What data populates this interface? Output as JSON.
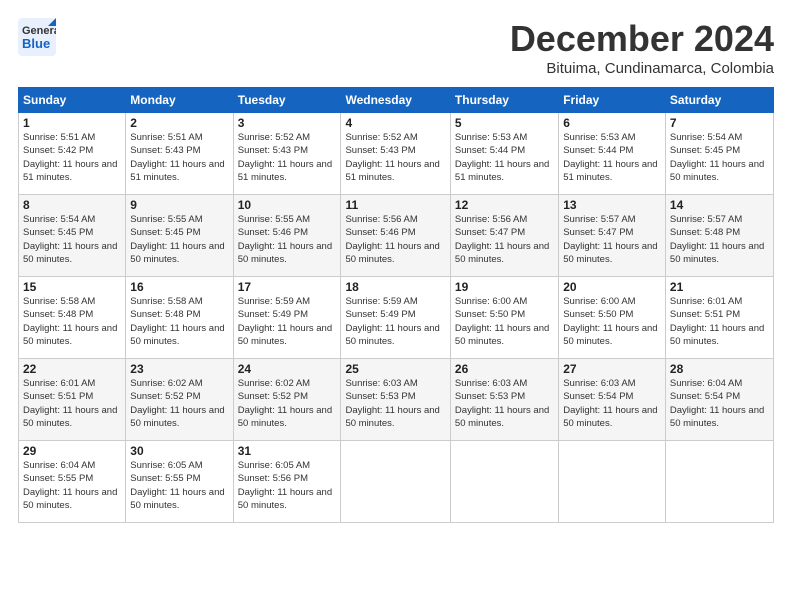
{
  "logo": {
    "line1": "General",
    "line2": "Blue"
  },
  "title": "December 2024",
  "subtitle": "Bituima, Cundinamarca, Colombia",
  "days_header": [
    "Sunday",
    "Monday",
    "Tuesday",
    "Wednesday",
    "Thursday",
    "Friday",
    "Saturday"
  ],
  "weeks": [
    [
      {
        "day": "1",
        "sunrise": "Sunrise: 5:51 AM",
        "sunset": "Sunset: 5:42 PM",
        "daylight": "Daylight: 11 hours and 51 minutes."
      },
      {
        "day": "2",
        "sunrise": "Sunrise: 5:51 AM",
        "sunset": "Sunset: 5:43 PM",
        "daylight": "Daylight: 11 hours and 51 minutes."
      },
      {
        "day": "3",
        "sunrise": "Sunrise: 5:52 AM",
        "sunset": "Sunset: 5:43 PM",
        "daylight": "Daylight: 11 hours and 51 minutes."
      },
      {
        "day": "4",
        "sunrise": "Sunrise: 5:52 AM",
        "sunset": "Sunset: 5:43 PM",
        "daylight": "Daylight: 11 hours and 51 minutes."
      },
      {
        "day": "5",
        "sunrise": "Sunrise: 5:53 AM",
        "sunset": "Sunset: 5:44 PM",
        "daylight": "Daylight: 11 hours and 51 minutes."
      },
      {
        "day": "6",
        "sunrise": "Sunrise: 5:53 AM",
        "sunset": "Sunset: 5:44 PM",
        "daylight": "Daylight: 11 hours and 51 minutes."
      },
      {
        "day": "7",
        "sunrise": "Sunrise: 5:54 AM",
        "sunset": "Sunset: 5:45 PM",
        "daylight": "Daylight: 11 hours and 50 minutes."
      }
    ],
    [
      {
        "day": "8",
        "sunrise": "Sunrise: 5:54 AM",
        "sunset": "Sunset: 5:45 PM",
        "daylight": "Daylight: 11 hours and 50 minutes."
      },
      {
        "day": "9",
        "sunrise": "Sunrise: 5:55 AM",
        "sunset": "Sunset: 5:45 PM",
        "daylight": "Daylight: 11 hours and 50 minutes."
      },
      {
        "day": "10",
        "sunrise": "Sunrise: 5:55 AM",
        "sunset": "Sunset: 5:46 PM",
        "daylight": "Daylight: 11 hours and 50 minutes."
      },
      {
        "day": "11",
        "sunrise": "Sunrise: 5:56 AM",
        "sunset": "Sunset: 5:46 PM",
        "daylight": "Daylight: 11 hours and 50 minutes."
      },
      {
        "day": "12",
        "sunrise": "Sunrise: 5:56 AM",
        "sunset": "Sunset: 5:47 PM",
        "daylight": "Daylight: 11 hours and 50 minutes."
      },
      {
        "day": "13",
        "sunrise": "Sunrise: 5:57 AM",
        "sunset": "Sunset: 5:47 PM",
        "daylight": "Daylight: 11 hours and 50 minutes."
      },
      {
        "day": "14",
        "sunrise": "Sunrise: 5:57 AM",
        "sunset": "Sunset: 5:48 PM",
        "daylight": "Daylight: 11 hours and 50 minutes."
      }
    ],
    [
      {
        "day": "15",
        "sunrise": "Sunrise: 5:58 AM",
        "sunset": "Sunset: 5:48 PM",
        "daylight": "Daylight: 11 hours and 50 minutes."
      },
      {
        "day": "16",
        "sunrise": "Sunrise: 5:58 AM",
        "sunset": "Sunset: 5:48 PM",
        "daylight": "Daylight: 11 hours and 50 minutes."
      },
      {
        "day": "17",
        "sunrise": "Sunrise: 5:59 AM",
        "sunset": "Sunset: 5:49 PM",
        "daylight": "Daylight: 11 hours and 50 minutes."
      },
      {
        "day": "18",
        "sunrise": "Sunrise: 5:59 AM",
        "sunset": "Sunset: 5:49 PM",
        "daylight": "Daylight: 11 hours and 50 minutes."
      },
      {
        "day": "19",
        "sunrise": "Sunrise: 6:00 AM",
        "sunset": "Sunset: 5:50 PM",
        "daylight": "Daylight: 11 hours and 50 minutes."
      },
      {
        "day": "20",
        "sunrise": "Sunrise: 6:00 AM",
        "sunset": "Sunset: 5:50 PM",
        "daylight": "Daylight: 11 hours and 50 minutes."
      },
      {
        "day": "21",
        "sunrise": "Sunrise: 6:01 AM",
        "sunset": "Sunset: 5:51 PM",
        "daylight": "Daylight: 11 hours and 50 minutes."
      }
    ],
    [
      {
        "day": "22",
        "sunrise": "Sunrise: 6:01 AM",
        "sunset": "Sunset: 5:51 PM",
        "daylight": "Daylight: 11 hours and 50 minutes."
      },
      {
        "day": "23",
        "sunrise": "Sunrise: 6:02 AM",
        "sunset": "Sunset: 5:52 PM",
        "daylight": "Daylight: 11 hours and 50 minutes."
      },
      {
        "day": "24",
        "sunrise": "Sunrise: 6:02 AM",
        "sunset": "Sunset: 5:52 PM",
        "daylight": "Daylight: 11 hours and 50 minutes."
      },
      {
        "day": "25",
        "sunrise": "Sunrise: 6:03 AM",
        "sunset": "Sunset: 5:53 PM",
        "daylight": "Daylight: 11 hours and 50 minutes."
      },
      {
        "day": "26",
        "sunrise": "Sunrise: 6:03 AM",
        "sunset": "Sunset: 5:53 PM",
        "daylight": "Daylight: 11 hours and 50 minutes."
      },
      {
        "day": "27",
        "sunrise": "Sunrise: 6:03 AM",
        "sunset": "Sunset: 5:54 PM",
        "daylight": "Daylight: 11 hours and 50 minutes."
      },
      {
        "day": "28",
        "sunrise": "Sunrise: 6:04 AM",
        "sunset": "Sunset: 5:54 PM",
        "daylight": "Daylight: 11 hours and 50 minutes."
      }
    ],
    [
      {
        "day": "29",
        "sunrise": "Sunrise: 6:04 AM",
        "sunset": "Sunset: 5:55 PM",
        "daylight": "Daylight: 11 hours and 50 minutes."
      },
      {
        "day": "30",
        "sunrise": "Sunrise: 6:05 AM",
        "sunset": "Sunset: 5:55 PM",
        "daylight": "Daylight: 11 hours and 50 minutes."
      },
      {
        "day": "31",
        "sunrise": "Sunrise: 6:05 AM",
        "sunset": "Sunset: 5:56 PM",
        "daylight": "Daylight: 11 hours and 50 minutes."
      },
      null,
      null,
      null,
      null
    ]
  ]
}
